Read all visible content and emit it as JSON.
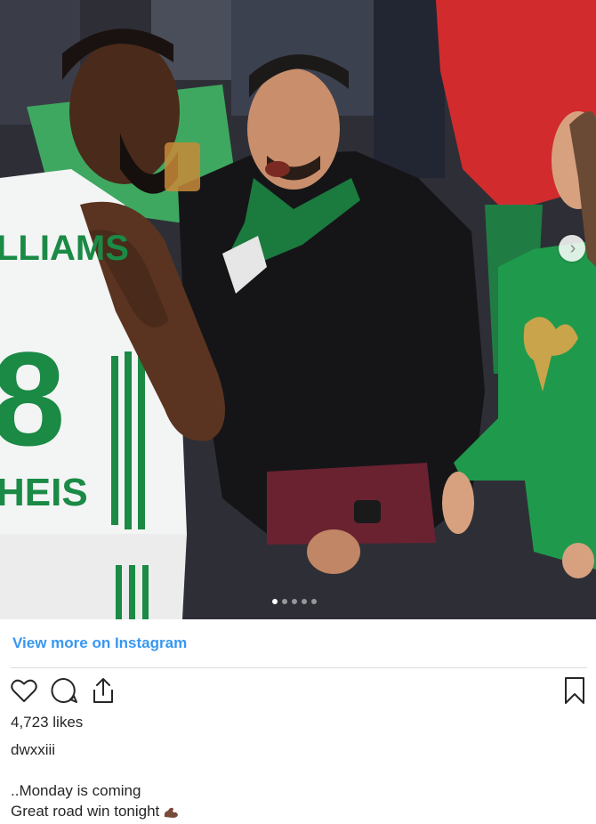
{
  "photo": {
    "alt_subject": "photo",
    "jersey_text_top": "LLIAMS",
    "jersey_number": "8",
    "jersey_text_bottom": "HEIS",
    "carousel": {
      "count": 5,
      "active": 0
    }
  },
  "link": {
    "label": "View more on Instagram"
  },
  "actions": {
    "like_icon": "heart-icon",
    "comment_icon": "comment-bubble-icon",
    "share_icon": "share-icon",
    "save_icon": "bookmark-icon"
  },
  "post": {
    "likes": "4,723 likes",
    "username": "dwxxiii",
    "caption_line1": "..Monday is coming",
    "caption_line2": "Great road win tonight",
    "caption_emoji": "flexed-biceps-emoji"
  },
  "colors": {
    "link": "#3897f0",
    "text": "#262626",
    "divider": "#dbdbdb",
    "jersey_green": "#1a8a45"
  }
}
